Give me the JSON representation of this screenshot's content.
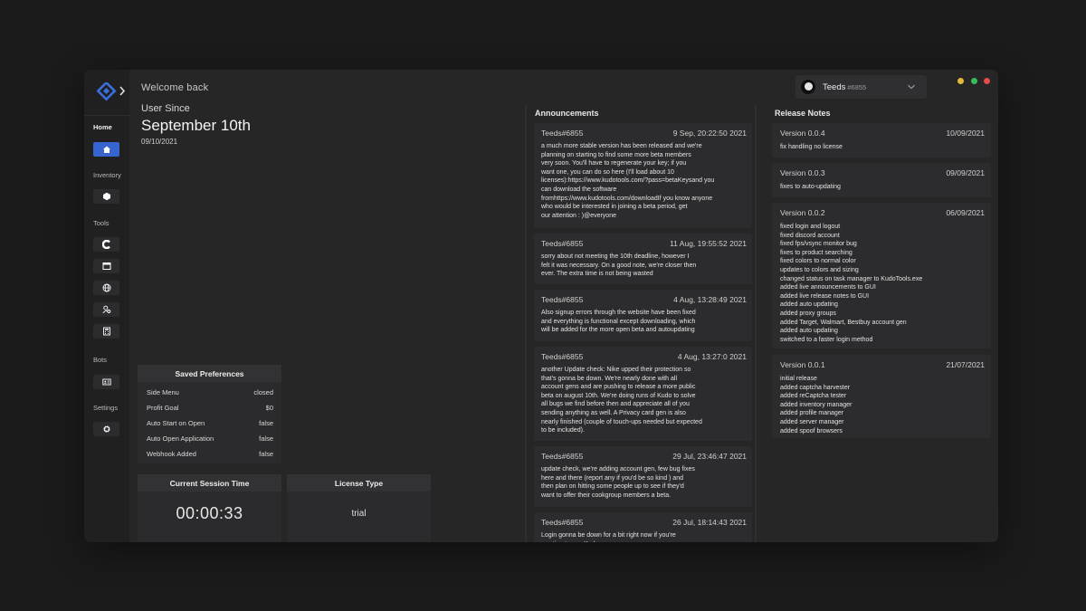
{
  "header": {
    "welcome": "Welcome back"
  },
  "user": {
    "name": "Teeds",
    "tag": "#6855"
  },
  "window_controls": {
    "minimize_color": "#e4b93b",
    "maximize_color": "#3bba5a",
    "close_color": "#e14b4b"
  },
  "sidebar": {
    "accent_color": "#3764cf",
    "sections": {
      "home": "Home",
      "inventory": "Inventory",
      "tools": "Tools",
      "bots": "Bots",
      "settings": "Settings"
    },
    "icons": [
      "home-icon",
      "cube-icon",
      "c-logo-icon",
      "browser-window-icon",
      "globe-icon",
      "user-search-icon",
      "calculator-icon",
      "id-card-icon",
      "gear-icon"
    ]
  },
  "user_since": {
    "label": "User Since",
    "date": "September 10th",
    "short_date": "09/10/2021"
  },
  "preferences": {
    "title": "Saved Preferences",
    "rows": [
      {
        "label": "Side Menu",
        "value": "closed"
      },
      {
        "label": "Profit Goal",
        "value": "$0"
      },
      {
        "label": "Auto Start on Open",
        "value": "false"
      },
      {
        "label": "Auto Open Application",
        "value": "false"
      },
      {
        "label": "Webhook Added",
        "value": "false"
      }
    ]
  },
  "session": {
    "title": "Current Session Time",
    "value": "00:00:33"
  },
  "license": {
    "title": "License Type",
    "value": "trial"
  },
  "announcements": {
    "title": "Announcements",
    "items": [
      {
        "author": "Teeds#6855",
        "date": "9 Sep, 20:22:50 2021",
        "text": "a much more stable version has been released and we're\nplanning on starting to find some more beta members\nvery soon. You'll have to regenerate your key; if you\nwant one, you can do so here (I'll load about 10\nlicenses):https://www.kudotools.com/?pass=betaKeysand you\ncan download the software\nfromhttps://www.kudotools.com/downloadIf you know anyone\nwho would be interested in joining a beta period, get\nour attention : )@everyone"
      },
      {
        "author": "Teeds#6855",
        "date": "11 Aug, 19:55:52 2021",
        "text": "sorry about not meeting the 10th deadline, however I\nfelt it was necessary. On a good note, we're closer then\never. The extra time is not being wasted"
      },
      {
        "author": "Teeds#6855",
        "date": "4 Aug, 13:28:49 2021",
        "text": "Also signup errors through the website have been fixed\nand everything is functional except downloading, which\nwill be added for the more open beta and autoupdating"
      },
      {
        "author": "Teeds#6855",
        "date": "4 Aug, 13:27:0 2021",
        "text": "another Update check: Nike upped their protection so\nthat's gonna be down. We're nearly done with all\naccount gens and are pushing to release a more public\nbeta on august 10th. We're doing runs of Kudo to solve\nall bugs we find before then and appreciate all of you\nsending anything as well. A Privacy card gen is also\nnearly finished (couple of touch-ups needed but expected\nto be included)."
      },
      {
        "author": "Teeds#6855",
        "date": "29 Jul, 23:46:47 2021",
        "text": "update check, we're adding account gen, few bug fixes\nhere and there (report any if you'd be so kind ) and\nthen plan on hitting some people up to see if they'd\nwant to offer their cookgroup members a beta."
      },
      {
        "author": "Teeds#6855",
        "date": "26 Jul, 18:14:43 2021",
        "text": "Login gonna be down for a bit right now if you're\nwanting to use Kudo"
      }
    ]
  },
  "release_notes": {
    "title": "Release Notes",
    "items": [
      {
        "version": "Version 0.0.4",
        "date": "10/09/2021",
        "notes": "fix handling no license"
      },
      {
        "version": "Version 0.0.3",
        "date": "09/09/2021",
        "notes": "fixes to auto-updating"
      },
      {
        "version": "Version 0.0.2",
        "date": "06/09/2021",
        "notes": "fixed login and logout\nfixed discord account\nfixed fps/vsync monitor bug\nfixes to product searching\nfixed colors to normal color\nupdates to colors and sizing\nchanged status on task manager to KudoTools.exe\nadded live announcements to GUI\nadded live release notes to GUI\nadded auto updating\nadded proxy groups\nadded Target, Walmart, Bestbuy account gen\nadded auto updating\nswitched to a faster login method"
      },
      {
        "version": "Version 0.0.1",
        "date": "21/07/2021",
        "notes": "initial release\nadded captcha harvester\nadded reCaptcha tester\nadded inventory manager\nadded profile manager\nadded server manager\nadded spoof browsers"
      }
    ]
  }
}
